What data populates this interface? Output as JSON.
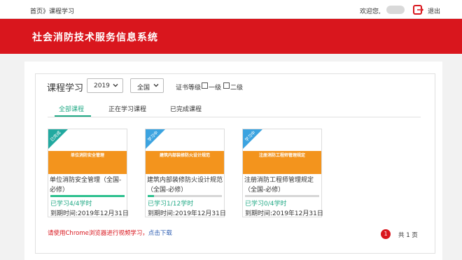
{
  "header": {
    "breadcrumb_home": "首页》",
    "breadcrumb_current": "课程学习",
    "welcome": "欢迎您,",
    "logout": "退出"
  },
  "banner": {
    "title": "社会消防技术服务信息系统"
  },
  "filters": {
    "label": "课程学习",
    "year": "2019",
    "region": "全国",
    "cert_label": "证书等级",
    "level1": "一级",
    "level2": "二级"
  },
  "tabs": [
    "全部课程",
    "正在学习课程",
    "已完成课程"
  ],
  "courses": [
    {
      "thumb_title": "单位消防安全管理",
      "ribbon": "已完成",
      "name": "单位消防安全管理（全国-必修）",
      "progress_fraction": 1.0,
      "progress_text": "已学习4/4学时",
      "deadline": "到期时间:2019年12月31日"
    },
    {
      "thumb_title": "建筑内部装修防火设计规范",
      "ribbon": "学习中",
      "name": "建筑内部装修防火设计规范（全国-必修）",
      "progress_fraction": 0.083,
      "progress_text": "已学习1/12学时",
      "deadline": "到期时间:2019年12月31日"
    },
    {
      "thumb_title": "注册消防工程师管理规定",
      "ribbon": "学习中",
      "name": "注册消防工程师管理规定（全国-必修）",
      "progress_fraction": 0,
      "progress_text": "已学习0/4学时",
      "deadline": "到期时间:2019年12月31日"
    }
  ],
  "notice": {
    "text": "请使用Chrome浏览器进行视频学习，",
    "link": "点击下载"
  },
  "pagination": {
    "current": "1",
    "total": "共 1 页"
  },
  "colors": {
    "brand_red": "#d9161d",
    "accent_green": "#21a985",
    "thumb_orange": "#f3941d"
  }
}
